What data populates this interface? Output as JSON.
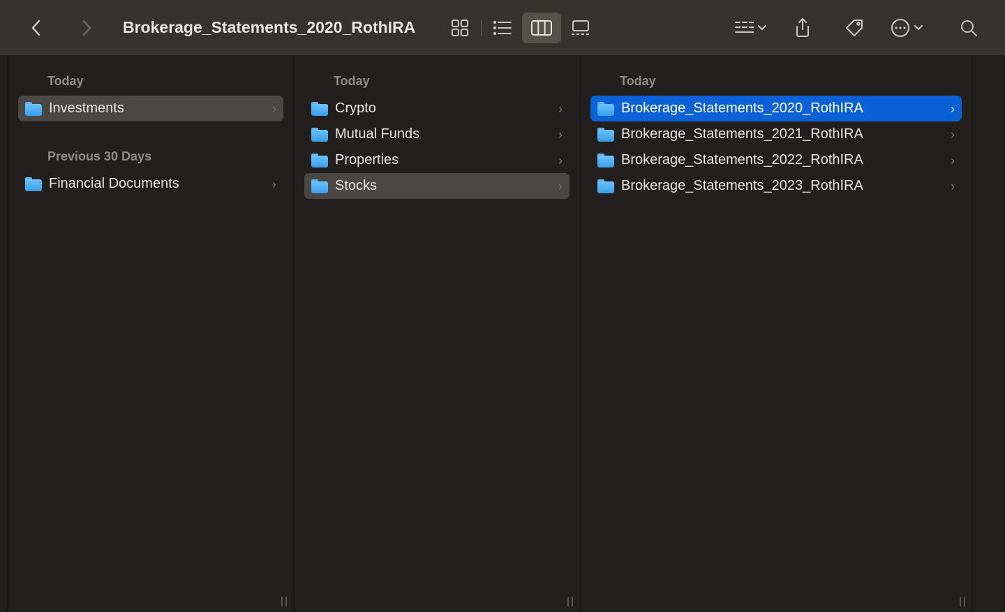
{
  "title": "Brokerage_Statements_2020_RothIRA",
  "columns": [
    {
      "sections": [
        {
          "header": "Today",
          "items": [
            {
              "label": "Investments",
              "folder": true,
              "hasChildren": true,
              "selected": "grey"
            }
          ]
        },
        {
          "header": "Previous 30 Days",
          "items": [
            {
              "label": "Financial Documents",
              "folder": true,
              "hasChildren": true
            }
          ]
        }
      ]
    },
    {
      "sections": [
        {
          "header": "Today",
          "items": [
            {
              "label": "Crypto",
              "folder": true,
              "hasChildren": true
            },
            {
              "label": "Mutual Funds",
              "folder": true,
              "hasChildren": true
            },
            {
              "label": "Properties",
              "folder": true,
              "hasChildren": true
            },
            {
              "label": "Stocks",
              "folder": true,
              "hasChildren": true,
              "selected": "grey"
            }
          ]
        }
      ]
    },
    {
      "sections": [
        {
          "header": "Today",
          "items": [
            {
              "label": "Brokerage_Statements_2020_RothIRA",
              "folder": true,
              "hasChildren": true,
              "selected": "blue"
            },
            {
              "label": "Brokerage_Statements_2021_RothIRA",
              "folder": true,
              "hasChildren": true
            },
            {
              "label": "Brokerage_Statements_2022_RothIRA",
              "folder": true,
              "hasChildren": true
            },
            {
              "label": "Brokerage_Statements_2023_RothIRA",
              "folder": true,
              "hasChildren": true
            }
          ]
        }
      ]
    }
  ]
}
